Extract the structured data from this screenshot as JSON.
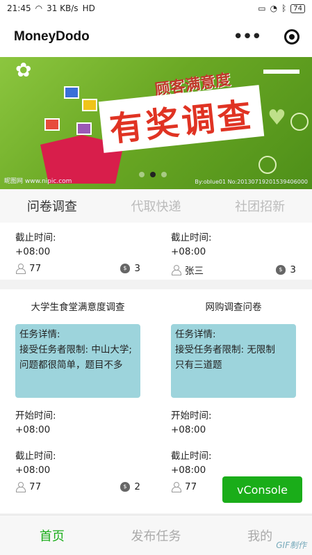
{
  "status": {
    "time": "21:45",
    "speed": "31 KB/s",
    "net": "HD",
    "battery": "74"
  },
  "navbar": {
    "title": "MoneyDodo"
  },
  "banner": {
    "subtitle": "顾客满意度",
    "title": "有奖调查",
    "watermark_left": "昵图网 www.nipic.com",
    "watermark_right": "By:oblue01 No:20130719201539406000",
    "slides": 3,
    "active_slide": 1
  },
  "tabs": [
    "问卷调查",
    "代取快递",
    "社团招新"
  ],
  "active_tab": 0,
  "cards_top": [
    {
      "deadline_label": "截止时间:",
      "deadline": "+08:00",
      "publisher": "77",
      "reward": "3"
    },
    {
      "deadline_label": "截止时间:",
      "deadline": "+08:00",
      "publisher": "张三",
      "reward": "3"
    }
  ],
  "cards": [
    {
      "title": "大学生食堂满意度调查",
      "detail_label": "任务详情:",
      "detail_lines": [
        "接受任务者限制: 中山大学;",
        "问题都很简单，题目不多"
      ],
      "start_label": "开始时间:",
      "start": "+08:00",
      "deadline_label": "截止时间:",
      "deadline": "+08:00",
      "publisher": "77",
      "reward": "2"
    },
    {
      "title": "网购调查问卷",
      "detail_label": "任务详情:",
      "detail_lines": [
        "接受任务者限制: 无限制",
        "只有三道题"
      ],
      "start_label": "开始时间:",
      "start": "+08:00",
      "deadline_label": "截止时间:",
      "deadline": "+08:00",
      "publisher": "77",
      "reward": ""
    }
  ],
  "vconsole": "vConsole",
  "tabbar": [
    "首页",
    "发布任务",
    "我的"
  ],
  "active_tabbar": 0,
  "gif_mark": "GIF制作",
  "colors": {
    "accent": "#1aad19",
    "detail_bg": "#9dd4dc",
    "banner": "#6aa824"
  }
}
